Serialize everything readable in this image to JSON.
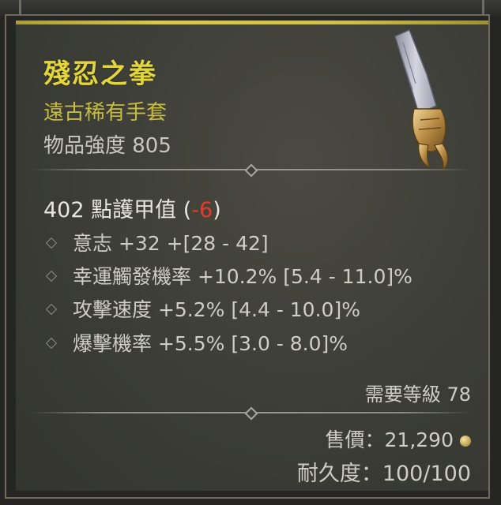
{
  "item": {
    "name": "殘忍之拳",
    "type": "遠古稀有手套",
    "power_label": "物品強度 805",
    "icon": "gauntlet-icon"
  },
  "armor": {
    "label": "402 點護甲值",
    "open_paren": "(",
    "delta": "-6",
    "close_paren": ")"
  },
  "affixes": [
    "意志 +32 +[28 - 42]",
    "幸運觸發機率 +10.2% [5.4 - 11.0]%",
    "攻擊速度 +5.2% [4.4 - 10.0]%",
    "爆擊機率 +5.5% [3.0 - 8.0]%"
  ],
  "footer": {
    "required_level": "需要等級 78",
    "price_label": "售價：21,290",
    "durability_label": "耐久度：100/100"
  },
  "colors": {
    "title": "#e3d63c",
    "subtitle": "#c8bd3f",
    "negative": "#e53b2d",
    "panel": "#3e3f38"
  }
}
